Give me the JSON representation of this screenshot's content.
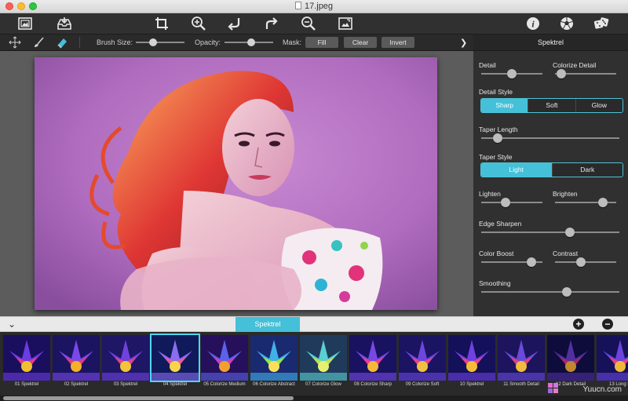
{
  "window": {
    "title": "17.jpeg"
  },
  "toolbar": {
    "icons": [
      "picture-frame-icon",
      "tray-save-icon",
      "crop-icon",
      "zoom-in-icon",
      "undo-icon",
      "redo-icon",
      "zoom-out-icon",
      "fit-image-icon",
      "info-icon",
      "soccer-ball-icon",
      "dice-icon"
    ]
  },
  "toolbar2": {
    "brush_size_label": "Brush Size:",
    "brush_size_value": 0.35,
    "opacity_label": "Opacity:",
    "opacity_value": 0.55,
    "mask_label": "Mask:",
    "fill_label": "Fill",
    "clear_label": "Clear",
    "invert_label": "Invert"
  },
  "panel": {
    "title": "Spektrel",
    "detail_label": "Detail",
    "detail_value": 0.5,
    "colorize_detail_label": "Colorize Detail",
    "colorize_detail_value": 0.1,
    "detail_style_label": "Detail Style",
    "detail_style_options": [
      "Sharp",
      "Soft",
      "Glow"
    ],
    "detail_style_selected": "Sharp",
    "taper_length_label": "Taper Length",
    "taper_length_value": 0.12,
    "taper_style_label": "Taper Style",
    "taper_style_options": [
      "Light",
      "Dark"
    ],
    "taper_style_selected": "Light",
    "lighten_label": "Lighten",
    "lighten_value": 0.4,
    "brighten_label": "Brighten",
    "brighten_value": 0.78,
    "edge_sharpen_label": "Edge Sharpen",
    "edge_sharpen_value": 0.64,
    "color_boost_label": "Color Boost",
    "color_boost_value": 0.82,
    "contrast_label": "Contrast",
    "contrast_value": 0.42,
    "smoothing_label": "Smoothing",
    "smoothing_value": 0.62
  },
  "strip": {
    "active_tab": "Spektrel",
    "add_symbol": "+",
    "remove_symbol": "−",
    "presets": [
      "01 Spektrel",
      "02 Spektrel",
      "03 Spektrel",
      "04 Spektrel",
      "05 Colorize Medium",
      "06 Colorize Abstract",
      "07 Colorize Glow",
      "08 Colorize Sharp",
      "09 Colorize Soft",
      "10 Spektrel",
      "11 Smooth Detail",
      "12 Dark Detail",
      "13 Long Li"
    ],
    "selected_index": 3
  },
  "watermark": "Yuucn.com",
  "colors": {
    "accent": "#44c0d8",
    "panel_bg": "#303030",
    "canvas_bg": "#5c5c5c"
  }
}
